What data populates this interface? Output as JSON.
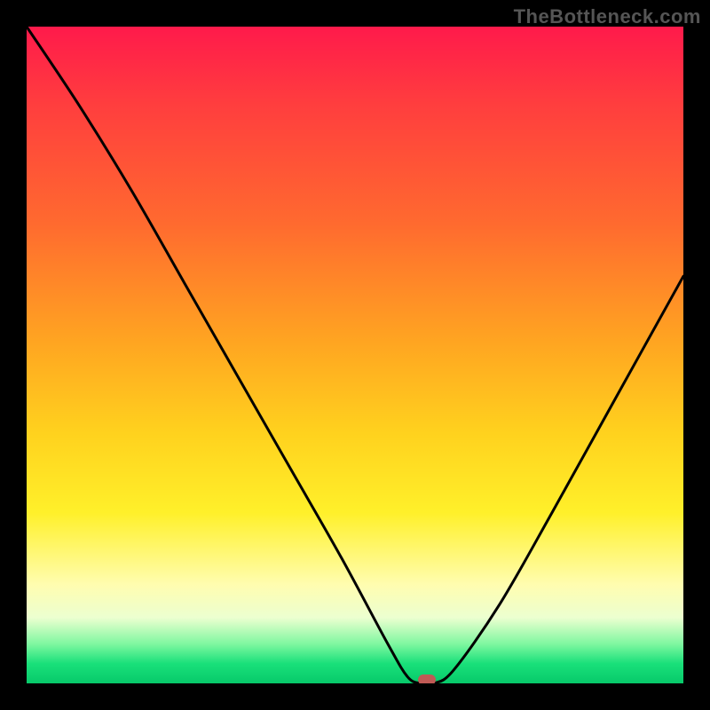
{
  "watermark": "TheBottleneck.com",
  "chart_data": {
    "type": "line",
    "title": "",
    "xlabel": "",
    "ylabel": "",
    "xlim": [
      0,
      100
    ],
    "ylim": [
      0,
      100
    ],
    "grid": false,
    "legend": false,
    "series": [
      {
        "name": "bottleneck-curve",
        "x": [
          0,
          8,
          16,
          24,
          32,
          40,
          48,
          55,
          58,
          60,
          62,
          65,
          72,
          80,
          90,
          100
        ],
        "y": [
          100,
          88,
          75,
          61,
          47,
          33,
          19,
          6,
          1,
          0,
          0,
          2,
          12,
          26,
          44,
          62
        ]
      }
    ],
    "min_point": {
      "x": 61,
      "y": 0
    },
    "gradient_stops": [
      {
        "pos": 0,
        "color": "#ff1a4b"
      },
      {
        "pos": 12,
        "color": "#ff3e3e"
      },
      {
        "pos": 30,
        "color": "#ff6a2f"
      },
      {
        "pos": 48,
        "color": "#ffa521"
      },
      {
        "pos": 62,
        "color": "#ffd21e"
      },
      {
        "pos": 74,
        "color": "#fff02a"
      },
      {
        "pos": 85,
        "color": "#fffdb0"
      },
      {
        "pos": 90,
        "color": "#ecffd0"
      },
      {
        "pos": 94,
        "color": "#7ff7a0"
      },
      {
        "pos": 97,
        "color": "#19e07a"
      },
      {
        "pos": 100,
        "color": "#07c96a"
      }
    ]
  }
}
